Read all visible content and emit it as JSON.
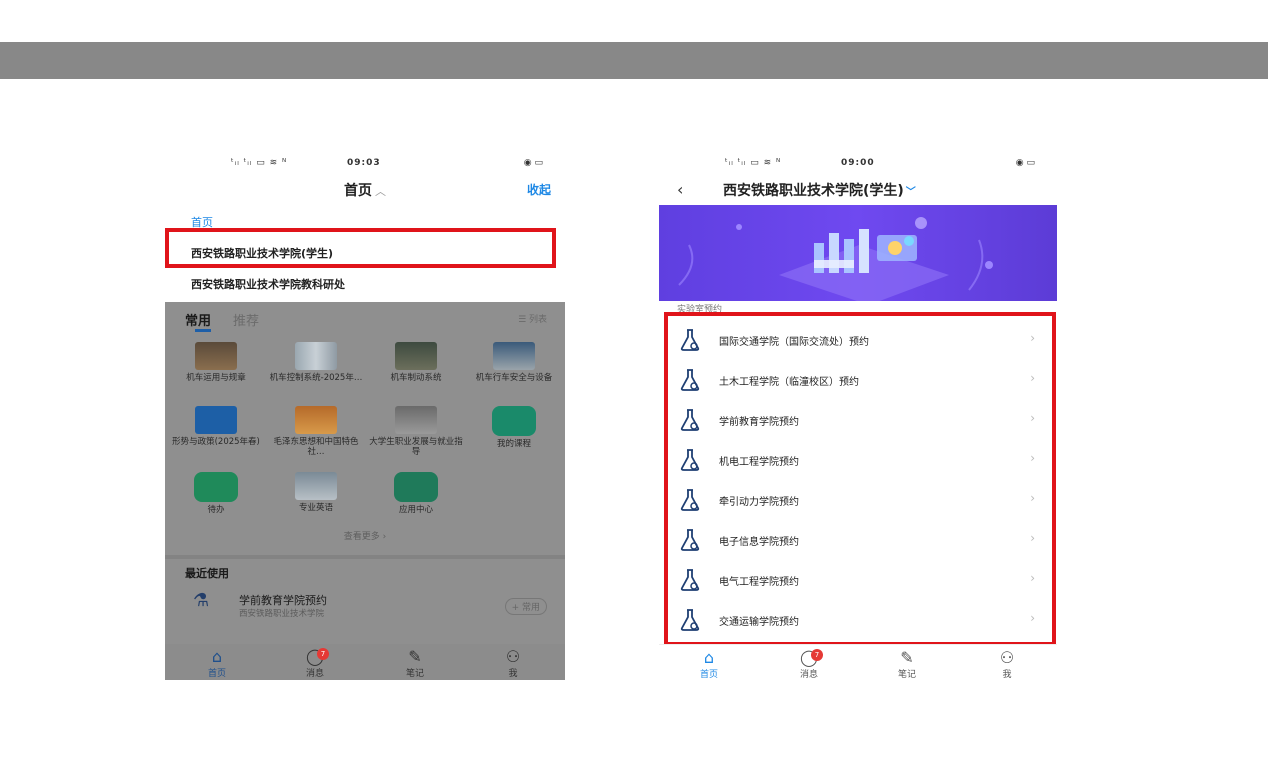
{
  "left_phone": {
    "status": {
      "signal": "ᵗᵢₗ ᵗᵢₗ ▭ ≋ ᴺ",
      "time": "09:03",
      "battery": "◉ ▭"
    },
    "title": "首页",
    "collapse_label": "收起",
    "menu": {
      "current": "首页",
      "items": [
        "西安铁路职业技术学院(学生)",
        "西安铁路职业技术学院教科研处"
      ]
    },
    "tabs": {
      "active": "常用",
      "inactive": "推荐",
      "list_view": "☰ 列表"
    },
    "grid": [
      {
        "label": "机车运用与规章"
      },
      {
        "label": "机车控制系统-2025年…"
      },
      {
        "label": "机车制动系统"
      },
      {
        "label": "机车行车安全与设备"
      },
      {
        "label": "形势与政策(2025年春)"
      },
      {
        "label": "毛泽东思想和中国特色社…"
      },
      {
        "label": "大学生职业发展与就业指导"
      },
      {
        "label": "我的课程"
      },
      {
        "label": "待办"
      },
      {
        "label": "专业英语"
      },
      {
        "label": "应用中心"
      }
    ],
    "see_more": "查看更多 ›",
    "recent": {
      "title": "最近使用",
      "name": "学前教育学院预约",
      "sub": "西安铁路职业技术学院",
      "add": "+ 常用"
    },
    "bottom_nav": [
      {
        "label": "首页",
        "icon": "⌂"
      },
      {
        "label": "消息",
        "icon": "◯",
        "badge": "7"
      },
      {
        "label": "笔记",
        "icon": "✎"
      },
      {
        "label": "我",
        "icon": "⚇"
      }
    ]
  },
  "right_phone": {
    "status": {
      "signal": "ᵗᵢₗ ᵗᵢₗ ▭ ≋ ᴺ",
      "time": "09:00",
      "battery": "◉ ▭"
    },
    "back": "‹",
    "title": "西安铁路职业技术学院(学生)",
    "title_chevron": "﹀",
    "section_label": "实验室预约",
    "list": [
      "国际交通学院（国际交流处）预约",
      "土木工程学院（临潼校区）预约",
      "学前教育学院预约",
      "机电工程学院预约",
      "牵引动力学院预约",
      "电子信息学院预约",
      "电气工程学院预约",
      "交通运输学院预约"
    ],
    "arrow": "›",
    "bottom_nav": [
      {
        "label": "首页",
        "icon": "⌂"
      },
      {
        "label": "消息",
        "icon": "◯",
        "badge": "7"
      },
      {
        "label": "笔记",
        "icon": "✎"
      },
      {
        "label": "我",
        "icon": "⚇"
      }
    ]
  },
  "colors": {
    "accent": "#1e88e5",
    "highlight_border": "#e0141a",
    "overlay": "#8f8f8f",
    "banner": "#6f49f0"
  }
}
